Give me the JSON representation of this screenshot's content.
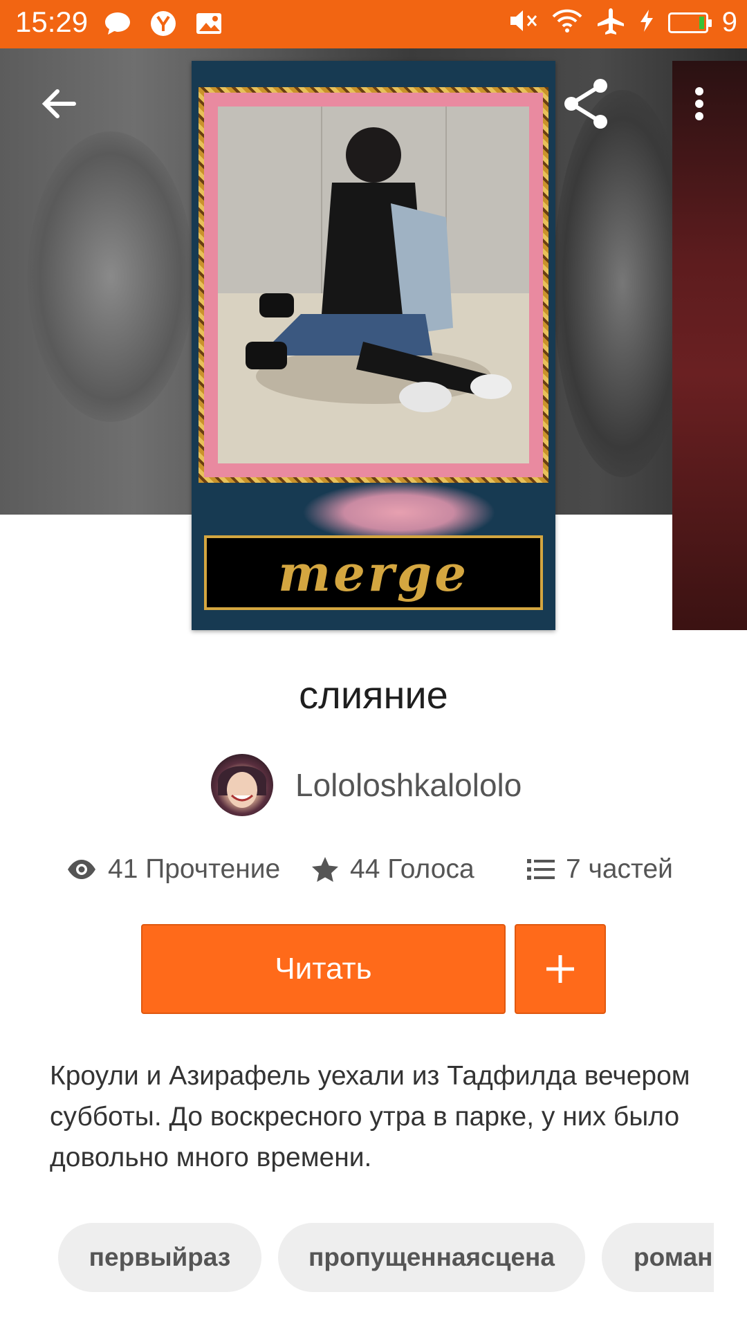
{
  "status_bar": {
    "time": "15:29",
    "battery_level": "9",
    "left_icons": [
      "chat-bubble-icon",
      "yandex-icon",
      "image-icon"
    ],
    "right_icons": [
      "mute-icon",
      "wifi-icon",
      "airplane-icon",
      "charging-icon",
      "battery-icon"
    ]
  },
  "toolbar": {
    "back_icon": "arrow-left-icon",
    "share_icon": "share-icon",
    "menu_icon": "more-vert-icon"
  },
  "cover": {
    "title_text": "merge"
  },
  "book": {
    "title": "слияние",
    "author": "Lololoshkalololo",
    "reads": "41 Прочтение",
    "votes": "44 Голоса",
    "parts": "7 частей",
    "read_button": "Читать",
    "description": "Кроули и Азирафель уехали из Тадфилда вечером субботы. До воскресного утра в парке, у них было довольно много времени.",
    "tags": [
      "первыйраз",
      "пропущеннаясцена",
      "роман"
    ]
  },
  "colors": {
    "accent": "#ff6a1a",
    "status_bar": "#f26512"
  }
}
